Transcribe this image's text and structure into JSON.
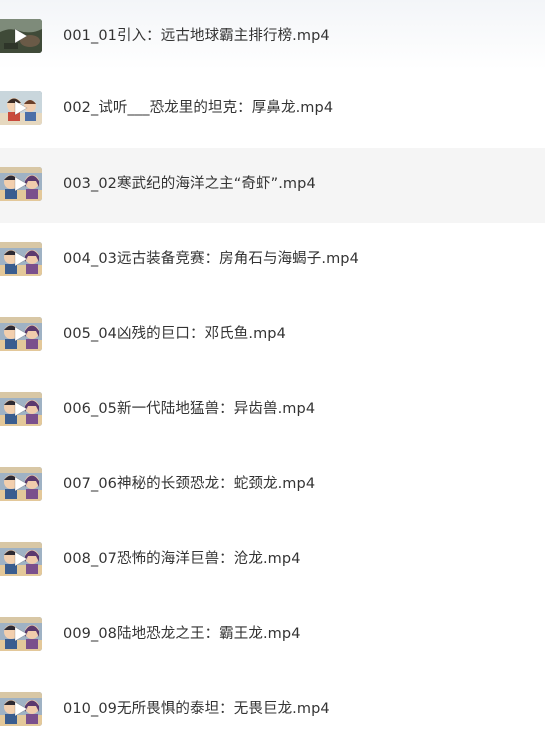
{
  "files": [
    {
      "name": "001_01引入：远古地球霸主排行榜.mp4",
      "thumb": "landscape",
      "selected": false
    },
    {
      "name": "002_试听___恐龙里的坦克：厚鼻龙.mp4",
      "thumb": "cartoon-boy",
      "selected": false
    },
    {
      "name": "003_02寒武纪的海洋之主“奇虾”.mp4",
      "thumb": "cartoon-pair",
      "selected": true
    },
    {
      "name": "004_03远古装备竞赛：房角石与海蝎子.mp4",
      "thumb": "cartoon-pair",
      "selected": false
    },
    {
      "name": "005_04凶残的巨口：邓氏鱼.mp4",
      "thumb": "cartoon-pair",
      "selected": false
    },
    {
      "name": "006_05新一代陆地猛兽：异齿兽.mp4",
      "thumb": "cartoon-pair",
      "selected": false
    },
    {
      "name": "007_06神秘的长颈恐龙：蛇颈龙.mp4",
      "thumb": "cartoon-pair",
      "selected": false
    },
    {
      "name": "008_07恐怖的海洋巨兽：沧龙.mp4",
      "thumb": "cartoon-pair",
      "selected": false
    },
    {
      "name": "009_08陆地恐龙之王：霸王龙.mp4",
      "thumb": "cartoon-pair",
      "selected": false
    },
    {
      "name": "010_09无所畏惧的泰坦：无畏巨龙.mp4",
      "thumb": "cartoon-pair",
      "selected": false
    }
  ],
  "colors": {
    "selected_row": "#f5f5f5",
    "text": "#333333"
  },
  "icons": {
    "play": "play-icon"
  }
}
